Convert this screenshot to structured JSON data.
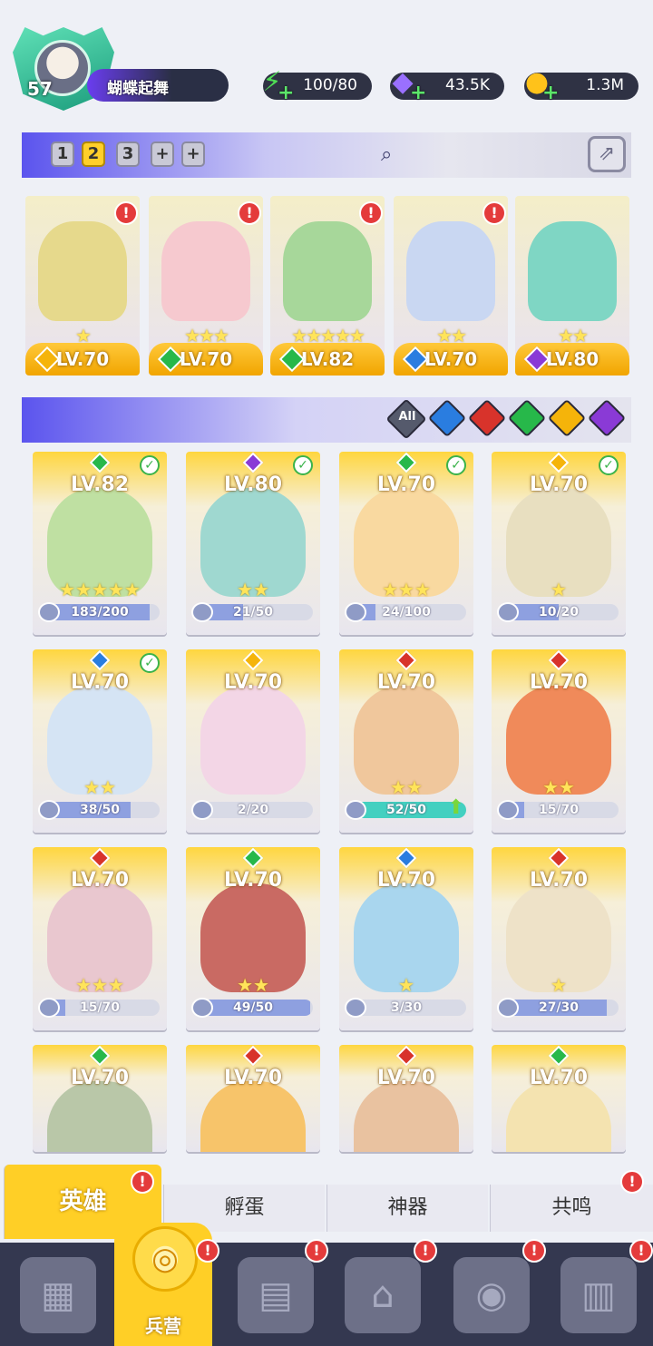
{
  "player": {
    "level": "57",
    "name": "蝴蝶起舞"
  },
  "resources": {
    "energy": "100/80",
    "gems": "43.5K",
    "gold": "1.3M"
  },
  "team_tabs": [
    "1",
    "2",
    "3",
    "+",
    "+"
  ],
  "team": [
    {
      "level": "LV.70",
      "stars": "★",
      "element_color": "#f5b40a",
      "art": "#e6d98c"
    },
    {
      "level": "LV.70",
      "stars": "★★★",
      "element_color": "#27b84a",
      "art": "#f6c9cf"
    },
    {
      "level": "LV.82",
      "stars": "★★★★★",
      "element_color": "#27b84a",
      "art": "#a7d79a"
    },
    {
      "level": "LV.70",
      "stars": "★★",
      "element_color": "#2a7de0",
      "art": "#c9d7f2"
    },
    {
      "level": "LV.80",
      "stars": "★★",
      "element_color": "#8a3ad6",
      "art": "#7fd6c4"
    }
  ],
  "filter": {
    "all_label": "All",
    "gems": [
      "#2a7de0",
      "#d8332b",
      "#27b84a",
      "#f5b40a",
      "#8a3ad6"
    ]
  },
  "heroes": [
    {
      "level": "LV.82",
      "stars": "★★★★★",
      "frag": "183/200",
      "progress": 0.915,
      "checked": true,
      "gem": "#27b84a",
      "art": "#bfe0a2"
    },
    {
      "level": "LV.80",
      "stars": "★★",
      "frag": "21/50",
      "progress": 0.42,
      "checked": true,
      "gem": "#8a3ad6",
      "art": "#9fd8d0"
    },
    {
      "level": "LV.70",
      "stars": "★★★",
      "frag": "24/100",
      "progress": 0.24,
      "checked": true,
      "gem": "#27b84a",
      "art": "#f9d9a0"
    },
    {
      "level": "LV.70",
      "stars": "★",
      "frag": "10/20",
      "progress": 0.5,
      "checked": true,
      "gem": "#f5b40a",
      "art": "#e8dfc0"
    },
    {
      "level": "LV.70",
      "stars": "★★",
      "frag": "38/50",
      "progress": 0.76,
      "checked": true,
      "gem": "#2a7de0",
      "art": "#d5e4f4"
    },
    {
      "level": "LV.70",
      "stars": "",
      "frag": "2/20",
      "progress": 0.1,
      "checked": false,
      "gem": "#f5b40a",
      "art": "#f3d6e6"
    },
    {
      "level": "LV.70",
      "stars": "★★",
      "frag": "52/50",
      "progress": 1.0,
      "checked": false,
      "gem": "#d8332b",
      "art": "#f0c79c",
      "up": true
    },
    {
      "level": "LV.70",
      "stars": "★★",
      "frag": "15/70",
      "progress": 0.214,
      "checked": false,
      "gem": "#d8332b",
      "art": "#f08a5a"
    },
    {
      "level": "LV.70",
      "stars": "★★★",
      "frag": "15/70",
      "progress": 0.214,
      "checked": false,
      "gem": "#d8332b",
      "art": "#e9c7cf"
    },
    {
      "level": "LV.70",
      "stars": "★★",
      "frag": "49/50",
      "progress": 0.98,
      "checked": false,
      "gem": "#27b84a",
      "art": "#c96a63"
    },
    {
      "level": "LV.70",
      "stars": "★",
      "frag": "3/30",
      "progress": 0.1,
      "checked": false,
      "gem": "#2a7de0",
      "art": "#a9d6ee"
    },
    {
      "level": "LV.70",
      "stars": "★",
      "frag": "27/30",
      "progress": 0.9,
      "checked": false,
      "gem": "#d8332b",
      "art": "#eee2c8"
    },
    {
      "level": "LV.70",
      "stars": "",
      "frag": "",
      "progress": 0,
      "checked": false,
      "gem": "#27b84a",
      "art": "#b9c7a8"
    },
    {
      "level": "LV.70",
      "stars": "",
      "frag": "",
      "progress": 0,
      "checked": false,
      "gem": "#d8332b",
      "art": "#f7c46a"
    },
    {
      "level": "LV.70",
      "stars": "",
      "frag": "",
      "progress": 0,
      "checked": false,
      "gem": "#d8332b",
      "art": "#e9c2a0"
    },
    {
      "level": "LV.70",
      "stars": "",
      "frag": "",
      "progress": 0,
      "checked": false,
      "gem": "#27b84a",
      "art": "#f4e3b0"
    }
  ],
  "sub_tabs": [
    "英雄",
    "孵蛋",
    "神器",
    "共鸣"
  ],
  "bottom_nav": {
    "active_label": "兵营",
    "items": [
      "cards-icon",
      "barracks-icon",
      "book-icon",
      "castle-icon",
      "guild-icon",
      "scroll-icon"
    ]
  }
}
